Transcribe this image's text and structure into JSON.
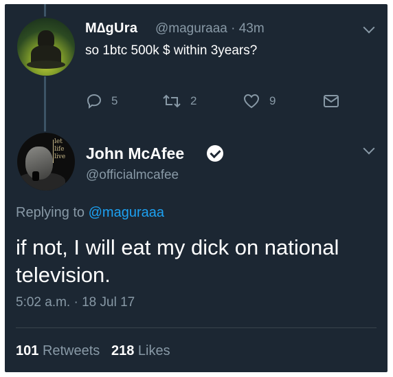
{
  "parent_tweet": {
    "display_name": "M∆gUra",
    "handle_time": "@maguraaa · 43m",
    "text": "so 1btc 500k $ within 3years?",
    "actions": {
      "reply_count": "5",
      "retweet_count": "2",
      "like_count": "9"
    }
  },
  "main_tweet": {
    "display_name": "John McAfee",
    "handle": "@officialmcafee",
    "avatar_tagline": [
      "let",
      "life",
      "live"
    ],
    "replying_prefix": "Replying to ",
    "replying_mention": "@maguraaa",
    "text": "if not, I will eat my dick on national television.",
    "timestamp": "5:02 a.m. · 18 Jul 17",
    "retweets_count": "101",
    "retweets_label": "Retweets",
    "likes_count": "218",
    "likes_label": "Likes"
  },
  "colors": {
    "background": "#1c2733",
    "primary_text": "#ffffff",
    "secondary_text": "#8899a6",
    "link": "#1da1f2"
  },
  "icons": {
    "reply": "reply-icon",
    "retweet": "retweet-icon",
    "like": "heart-icon",
    "dm": "envelope-icon",
    "menu": "chevron-down-icon",
    "verified": "verified-badge-icon"
  }
}
